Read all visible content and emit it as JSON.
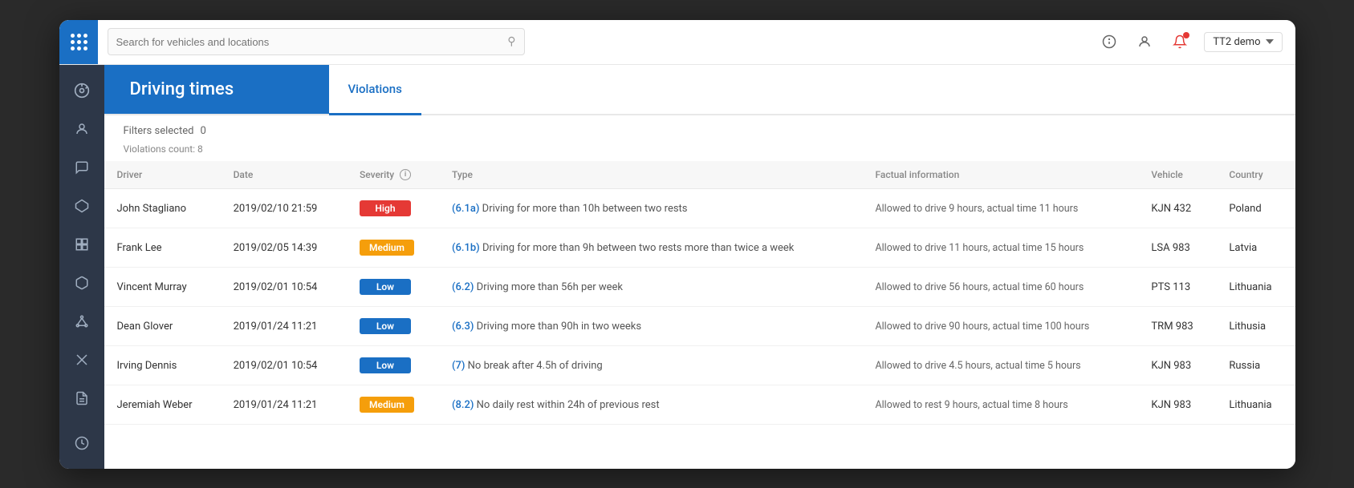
{
  "topbar": {
    "search_placeholder": "Search for vehicles and locations",
    "user_label": "TT2 demo"
  },
  "page": {
    "title": "Driving times",
    "tabs": [
      {
        "label": "Violations",
        "active": true
      }
    ]
  },
  "filters": {
    "label": "Filters selected",
    "count": "0"
  },
  "violations": {
    "count_label": "Violations count: 8"
  },
  "table": {
    "headers": [
      "Driver",
      "Date",
      "Severity",
      "Type",
      "Factual information",
      "Vehicle",
      "Country"
    ],
    "rows": [
      {
        "driver": "John Stagliano",
        "date": "2019/02/10 21:59",
        "severity": "High",
        "severity_class": "badge-high",
        "code": "(6.1a)",
        "type": "Driving for more than 10h between two rests",
        "factual": "Allowed to drive 9 hours, actual time 11 hours",
        "vehicle": "KJN 432",
        "country": "Poland"
      },
      {
        "driver": "Frank Lee",
        "date": "2019/02/05 14:39",
        "severity": "Medium",
        "severity_class": "badge-medium",
        "code": "(6.1b)",
        "type": "Driving for more than 9h between two rests more than twice a week",
        "factual": "Allowed to drive 11 hours, actual time 15 hours",
        "vehicle": "LSA 983",
        "country": "Latvia"
      },
      {
        "driver": "Vincent Murray",
        "date": "2019/02/01 10:54",
        "severity": "Low",
        "severity_class": "badge-low",
        "code": "(6.2)",
        "type": "Driving more than 56h per week",
        "factual": "Allowed to drive 56 hours, actual time 60 hours",
        "vehicle": "PTS 113",
        "country": "Lithuania"
      },
      {
        "driver": "Dean Glover",
        "date": "2019/01/24 11:21",
        "severity": "Low",
        "severity_class": "badge-low",
        "code": "(6.3)",
        "type": "Driving more than 90h in two weeks",
        "factual": "Allowed to drive 90 hours, actual time 100 hours",
        "vehicle": "TRM 983",
        "country": "Lithusia"
      },
      {
        "driver": "Irving Dennis",
        "date": "2019/02/01 10:54",
        "severity": "Low",
        "severity_class": "badge-low",
        "code": "(7)",
        "type": "No break after 4.5h of driving",
        "factual": "Allowed to drive 4.5 hours, actual time 5 hours",
        "vehicle": "KJN 983",
        "country": "Russia"
      },
      {
        "driver": "Jeremiah Weber",
        "date": "2019/01/24 11:21",
        "severity": "Medium",
        "severity_class": "badge-medium",
        "code": "(8.2)",
        "type": "No daily rest within 24h of previous rest",
        "factual": "Allowed to rest 9 hours, actual time 8 hours",
        "vehicle": "KJN 983",
        "country": "Lithuania"
      }
    ]
  },
  "sidebar": {
    "items": [
      {
        "name": "dashboard",
        "icon": "⊙"
      },
      {
        "name": "driver",
        "icon": "👤"
      },
      {
        "name": "messages",
        "icon": "💬"
      },
      {
        "name": "routes",
        "icon": "⬡"
      },
      {
        "name": "boxes",
        "icon": "⊞"
      },
      {
        "name": "cube",
        "icon": "◈"
      },
      {
        "name": "network",
        "icon": "⌘"
      },
      {
        "name": "tools",
        "icon": "✂"
      },
      {
        "name": "reports",
        "icon": "📋"
      },
      {
        "name": "clock",
        "icon": "🕐"
      }
    ]
  }
}
